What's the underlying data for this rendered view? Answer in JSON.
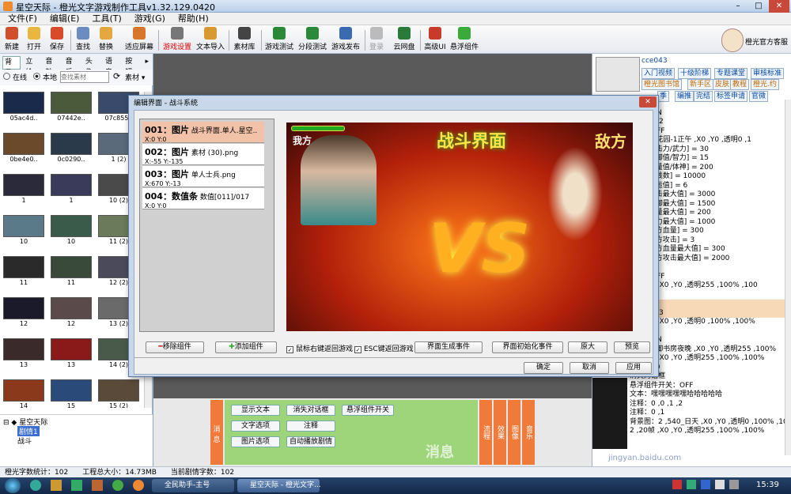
{
  "window": {
    "title": "星空天际 - 橙光文字游戏制作工具v1.32.129.0420"
  },
  "menu": [
    "文件(F)",
    "编辑(E)",
    "工具(T)",
    "游戏(G)",
    "帮助(H)"
  ],
  "toolbar": {
    "new": "新建",
    "open": "打开",
    "save": "保存",
    "find": "查找",
    "replace": "替换",
    "fit": "适应屏幕",
    "game_settings": "游戏设置",
    "text_import": "文本导入",
    "assets": "素材库",
    "game_test": "游戏测试",
    "branch_test": "分段测试",
    "publish": "游戏发布",
    "login": "登录",
    "cloud": "云网盘",
    "advanced_ui": "高级UI",
    "float": "悬浮组件",
    "support": "橙光官方客服"
  },
  "left": {
    "tabs": [
      "背景",
      "立绘",
      "音效",
      "音乐",
      "头像",
      "语音",
      "按钮"
    ],
    "source_online": "在线",
    "source_local": "本地",
    "search_placeholder": "查找素材",
    "assets_dropdown": "素材",
    "thumbs": [
      "05ac4d..",
      "07442e..",
      "07c855..",
      "0be4e0..",
      "0c0290..",
      "1 (2)",
      "1",
      "1",
      "10 (2)",
      "10",
      "10",
      "11 (2)",
      "11",
      "11",
      "12 (2)",
      "12",
      "12",
      "13 (2)",
      "13",
      "13",
      "14 (2)",
      "14",
      "15",
      "15 (2)"
    ],
    "tree": {
      "root": "星空天际",
      "selected": "剧情1",
      "child": "战斗"
    }
  },
  "dialog": {
    "title": "编辑界面 - 战斗系统",
    "components": [
      {
        "head": "001：图片",
        "desc": "战斗界面.单人.星空..",
        "pos": "X:0  Y:0"
      },
      {
        "head": "002：图片",
        "desc": "素材 (30).png",
        "pos": "X:-55  Y:-135"
      },
      {
        "head": "003：图片",
        "desc": "单人士兵.png",
        "pos": "X:670  Y:-13"
      },
      {
        "head": "004：数值条",
        "desc": "数值[011]/017",
        "pos": "X:0  Y:0"
      }
    ],
    "preview": {
      "battle_title": "战斗界面",
      "me": "我方",
      "enemy": "敌方",
      "vs": "VS"
    },
    "remove": "移除组件",
    "add": "添加组件",
    "chk_right": "鼠标右键返回游戏",
    "chk_esc": "ESC键返回游戏",
    "gen_event": "界面生成事件",
    "init_event": "界面初始化事件",
    "original": "原大",
    "preview_btn": "预览",
    "ok": "确定",
    "cancel": "取消",
    "apply": "应用"
  },
  "right": {
    "user": "cce043",
    "tags": [
      "入门视频",
      "十级阶梯",
      "专题课堂",
      "审核标准",
      "橙光图书馆",
      "新手区",
      "皮肤",
      "教程",
      "橙光.约",
      "季",
      "编推",
      "完结",
      "标签申请",
      "官微"
    ],
    "code": [
      "-N-T |",
      "开关：ON",
      "-E-T | 002",
      "开关：OFF",
      ",540_御花园-1正午 ,X0 ,Y0 ,透明0 ,1",
      "[009:攻击力/武力] = 30",
      "[010:防御值/智力] = 15",
      "[011:血量值/体神] = 200",
      "[012:金钱数] = 10000",
      "[014:幸运值] = 6",
      "[015:攻击最大值] = 3000",
      "[016:防御最大值] = 1500",
      "[017:血量最大值] = 200",
      "[018:精力最大值] = 1000",
      "[019:敌方血量] = 300",
      "[020:敌方攻击] = 3",
      "[021:敌方血量最大值] = 300",
      "[022:敌方攻击最大值] = 2000",
      "退上",
      "开关：OFF",
      "2 ,20帧 ,X0 ,Y0 ,透明255 ,100% ,100",
      "",
      " 文本",
      "-E-T | 003",
      "2 ,20帧 ,X0 ,Y0 ,透明0 ,100% ,100%",
      "",
      "开关：ON",
      "2 ,540_御书房夜晚 ,X0 ,Y0 ,透明255 ,100%",
      "2 ,20帧 ,X0 ,Y0 ,透明255 ,100% ,100%",
      "等待：30",
      "消失对话框",
      "悬浮组件开关：OFF",
      "文本：嘿嘿嘿嘿嘿哈哈哈哈哈",
      "注释：0 ,0 ,1 ,2",
      "注释：0 ,1",
      "背景图：2 ,540_日天 ,X0 ,Y0 ,透明0 ,100% ,100%",
      "2 ,20帧 ,X0 ,Y0 ,透明255 ,100% ,100%"
    ],
    "footer": "jingyan.baidu.com"
  },
  "bottom": {
    "buttons": [
      "显示文本",
      "消失对话框",
      "悬浮组件开关",
      "文字选项",
      "注释",
      "图片选项",
      "自动播放剧情"
    ],
    "tabs_left": "消息",
    "tabs_right": [
      "流程",
      "效果",
      "图像",
      "音乐"
    ],
    "watermark": "消息"
  },
  "status": {
    "count": "橙光字数统计：102",
    "size": "工程总大小：14.73MB",
    "current": "当前剧情字数：102"
  },
  "taskbar": {
    "task1": "全民助手-主号",
    "task2": "星空天际 - 橙光文字...",
    "time": "15:39"
  },
  "colors": {
    "accent": "#f07a3a",
    "selected": "#f2c2a8",
    "title_gold": "#ffe24a"
  }
}
